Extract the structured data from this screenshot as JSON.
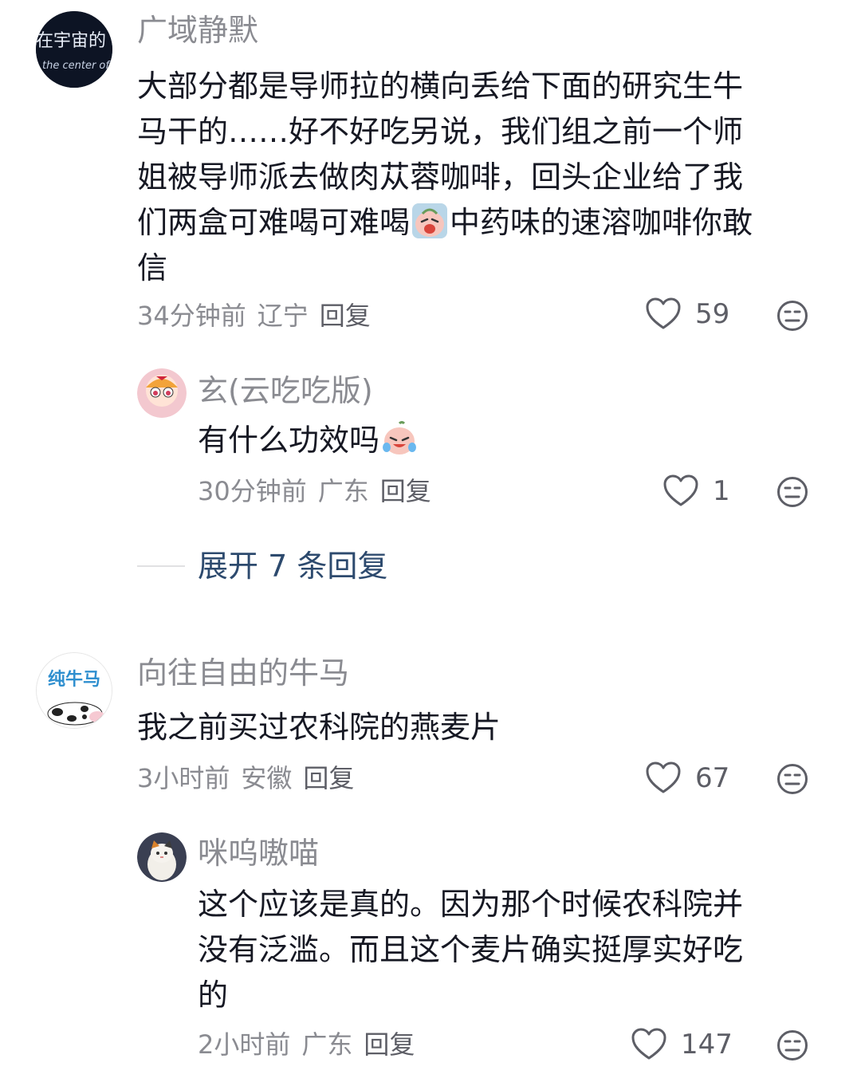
{
  "comments": [
    {
      "avatar_text_1": "在宇宙的",
      "avatar_text_2": "the center of",
      "username": "广域静默",
      "lines": [
        "大部分都是导师拉的横向丢给下面的研究生牛",
        "马干的……好不好吃另说，我们组之前一个师",
        "姐被导师派去做肉苁蓉咖啡，回头企业给了我"
      ],
      "line4_before": "们两盒可难喝可难喝",
      "line4_emoji": "crying-face-emoji",
      "line4_after": "中药味的速溶咖啡你敢",
      "line5": "信",
      "time": "34分钟前",
      "location": "辽宁",
      "reply_label": "回复",
      "likes": "59",
      "replies": [
        {
          "username": "玄(云吃吃版)",
          "text": "有什么功效吗",
          "emoji": "laughing-crying-emoji",
          "time": "30分钟前",
          "location": "广东",
          "reply_label": "回复",
          "likes": "1"
        }
      ],
      "expand_label": "展开 7 条回复"
    },
    {
      "avatar_text": "纯牛马",
      "username": "向往自由的牛马",
      "text": "我之前买过农科院的燕麦片",
      "time": "3小时前",
      "location": "安徽",
      "reply_label": "回复",
      "likes": "67",
      "replies": [
        {
          "username": "咪呜嗷喵",
          "lines": [
            "这个应该是真的。因为那个时候农科院并",
            "没有泛滥。而且这个麦片确实挺厚实好吃",
            "的"
          ],
          "time": "2小时前",
          "location": "广东",
          "reply_label": "回复",
          "likes": "147"
        }
      ]
    }
  ],
  "colors": {
    "text": "#161823",
    "secondary": "#8a8b91",
    "link": "#2d4a6e"
  }
}
